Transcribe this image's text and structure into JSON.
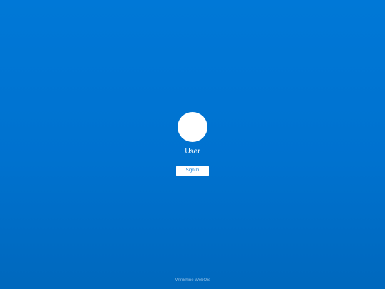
{
  "login": {
    "username": "User",
    "sign_in_label": "Sign In"
  },
  "footer": {
    "brand": "WinShine WebOS"
  },
  "colors": {
    "background_top": "#0078d7",
    "background_bottom": "#0068bd",
    "avatar": "#ffffff",
    "button_background": "#ffffff",
    "button_text": "#0078d7",
    "text": "#ffffff"
  },
  "icons": {
    "avatar": "user-avatar-circle"
  }
}
